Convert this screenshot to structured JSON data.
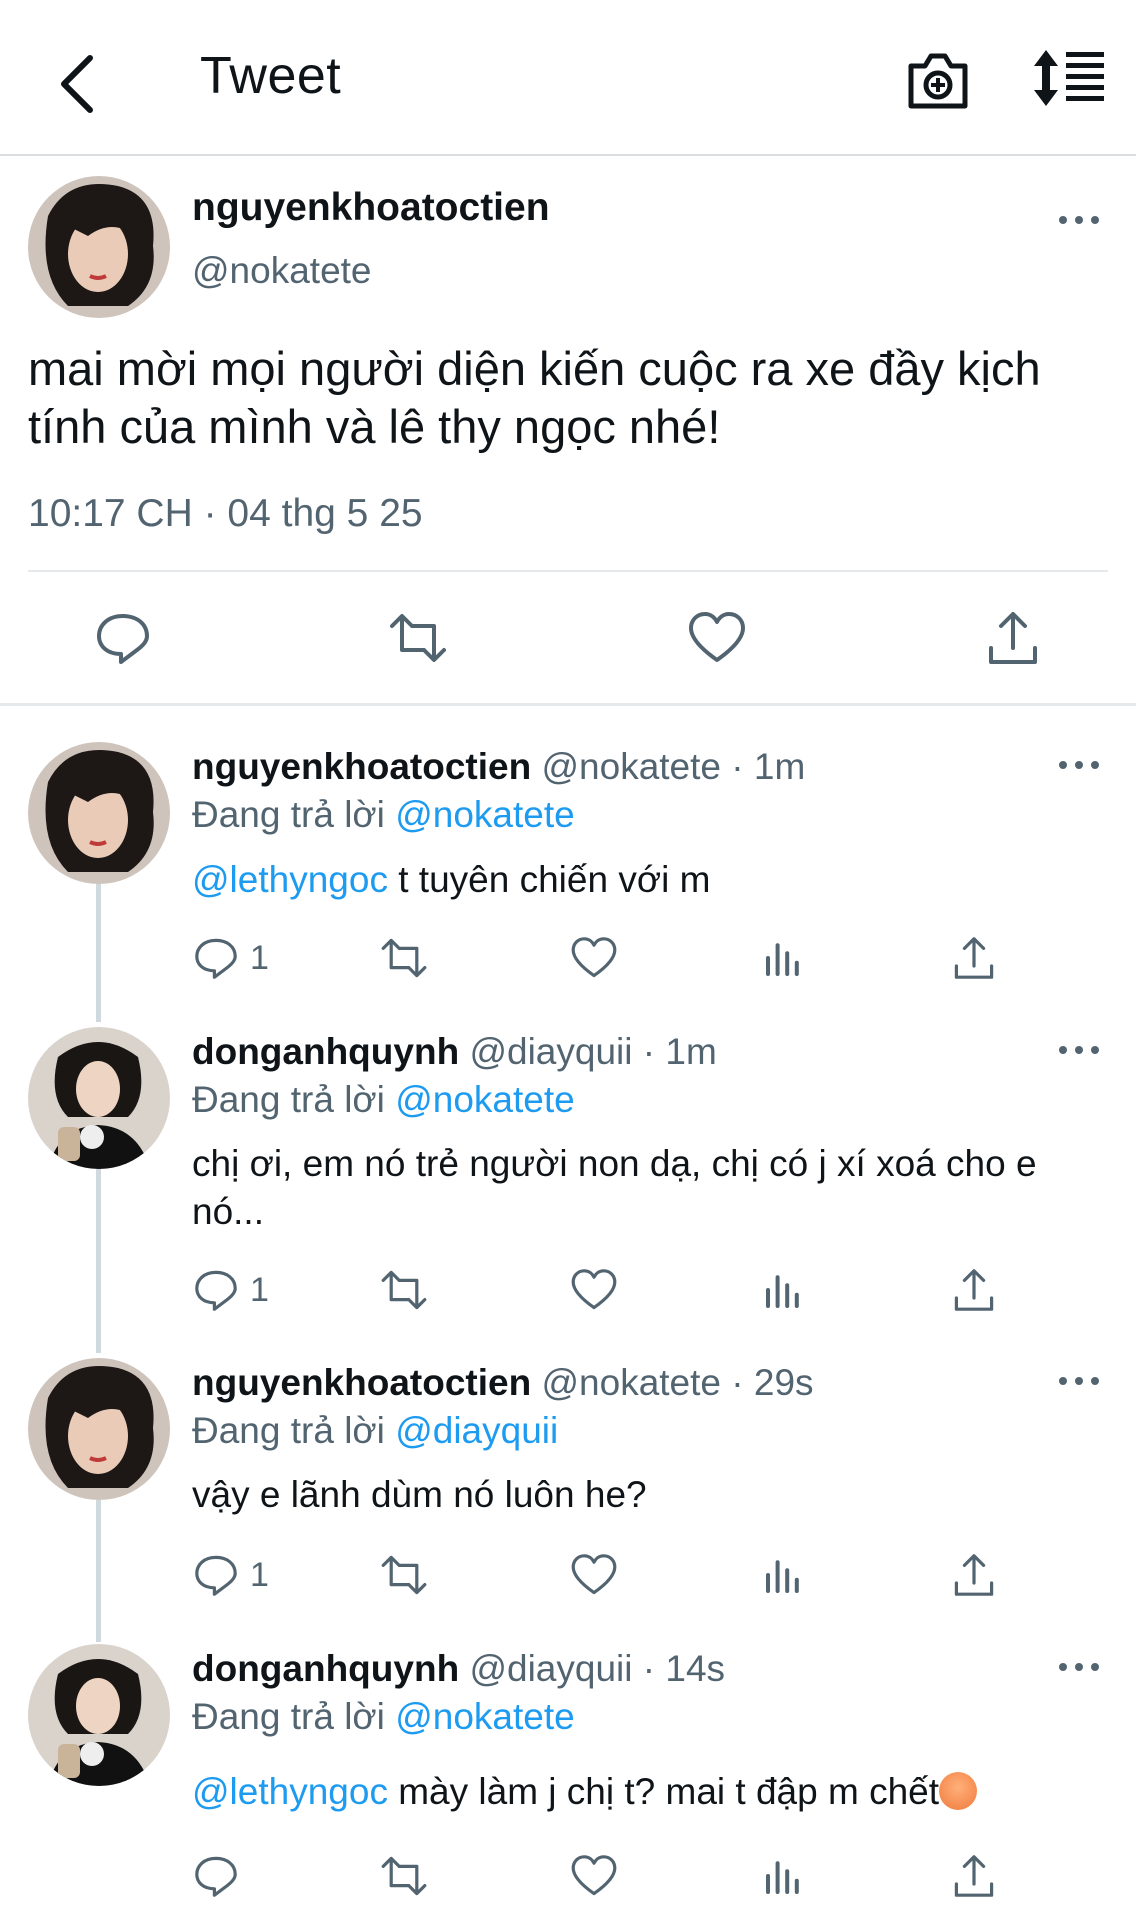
{
  "header": {
    "title": "Tweet",
    "back_icon": "chevron-left-icon",
    "camera_icon": "camera-add-icon",
    "sort_icon": "sort-list-icon"
  },
  "main_tweet": {
    "name": "nguyenkhoatoctien",
    "handle": "@nokatete",
    "text": "mai mời mọi người diện kiến cuộc ra xe đầy kịch tính của mình và lê thy ngọc nhé!",
    "time": "10:17 CH · 04 thg 5 25"
  },
  "replies": [
    {
      "name": "nguyenkhoatoctien",
      "meta": "@nokatete · 1m",
      "replying_prefix": "Đang trả lời ",
      "replying_to": "@nokatete",
      "mention": "@lethyngoc",
      "text": " t tuyên chiến với m",
      "reply_count": "1"
    },
    {
      "name": "donganhquynh",
      "meta": "@diayquii · 1m",
      "replying_prefix": "Đang trả lời ",
      "replying_to": "@nokatete",
      "mention": "",
      "text": "chị ơi, em nó trẻ người non dạ, chị có j xí xoá cho e nó...",
      "reply_count": "1"
    },
    {
      "name": "nguyenkhoatoctien",
      "meta": "@nokatete · 29s",
      "replying_prefix": "Đang trả lời ",
      "replying_to": "@diayquii",
      "mention": "",
      "text": "vậy e lãnh dùm nó luôn he?",
      "reply_count": "1"
    },
    {
      "name": "donganhquynh",
      "meta": "@diayquii · 14s",
      "replying_prefix": "Đang trả lời ",
      "replying_to": "@nokatete",
      "mention": "@lethyngoc",
      "text": " mày làm j chị t? mai t đập m chết",
      "reply_count": ""
    }
  ],
  "colors": {
    "link": "#1d9bf0",
    "muted": "#536471",
    "divider": "#e6e9eb"
  }
}
